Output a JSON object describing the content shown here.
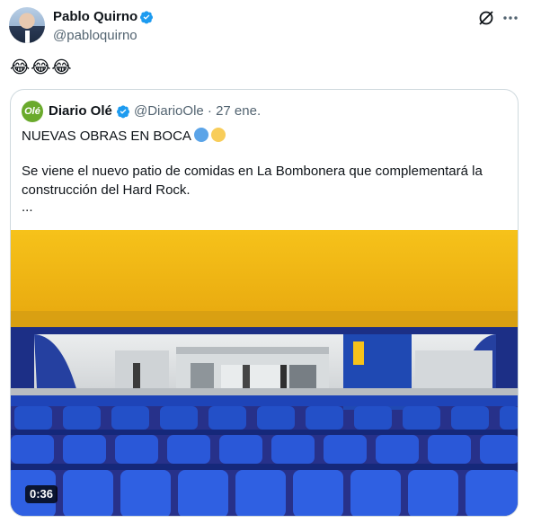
{
  "author": {
    "name": "Pablo Quirno",
    "handle": "@pabloquirno"
  },
  "post": {
    "text": "😂😂😂"
  },
  "quoted": {
    "logo_text": "Olé",
    "name": "Diario Olé",
    "handle_time": "@DiarioOle · 27 ene.",
    "headline": "NUEVAS OBRAS EN BOCA",
    "body": "Se viene el nuevo patio de comidas en La Bombonera que complementará la construcción del Hard Rock.",
    "ellipsis": "...",
    "video_duration": "0:36"
  },
  "colors": {
    "verified": "#1d9bf0",
    "boca_blue": "#1d4fb0",
    "boca_yellow": "#f5c518",
    "muted": "#536471",
    "border": "#cfd9de"
  },
  "icons": [
    "verified-icon",
    "grok-icon",
    "more-icon"
  ]
}
